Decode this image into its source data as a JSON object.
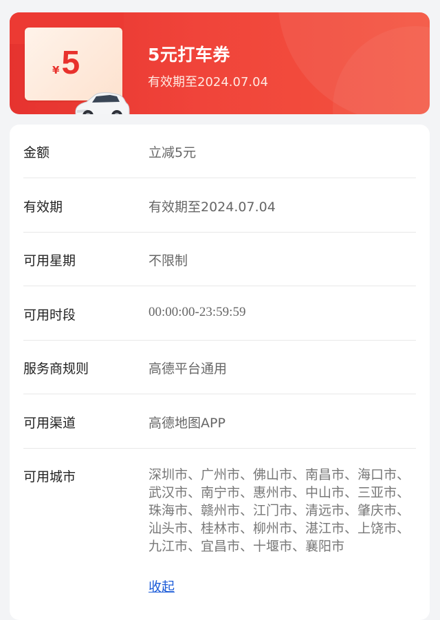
{
  "coupon": {
    "currency": "¥",
    "amount": "5",
    "title": "5元打车券",
    "validity": "有效期至2024.07.04"
  },
  "details": [
    {
      "label": "金额",
      "value": "立减5元"
    },
    {
      "label": "有效期",
      "value": "有效期至2024.07.04"
    },
    {
      "label": "可用星期",
      "value": "不限制"
    },
    {
      "label": "可用时段",
      "value": "00:00:00-23:59:59"
    },
    {
      "label": "服务商规则",
      "value": "高德平台通用"
    },
    {
      "label": "可用渠道",
      "value": "高德地图APP"
    },
    {
      "label": "可用城市",
      "value": "深圳市、广州市、佛山市、南昌市、海口市、武汉市、南宁市、惠州市、中山市、三亚市、珠海市、赣州市、江门市、清远市、肇庆市、汕头市、桂林市、柳州市、湛江市、上饶市、九江市、宜昌市、十堰市、襄阳市"
    }
  ],
  "collapse_label": "收起",
  "icons": {
    "car": "car-icon"
  },
  "colors": {
    "banner": "#ec3a33",
    "link": "#1b5bd8"
  }
}
